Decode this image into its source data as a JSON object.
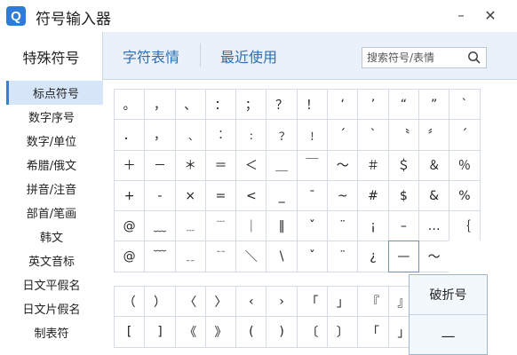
{
  "app": {
    "logo_letter": "Q",
    "title": "符号输入器",
    "minimize_glyph": "–",
    "close_glyph": "✕"
  },
  "tabs": [
    {
      "label": "特殊符号",
      "active": true
    },
    {
      "label": "字符表情",
      "active": false
    },
    {
      "label": "最近使用",
      "active": false
    }
  ],
  "search": {
    "placeholder": "搜索符号/表情",
    "value": ""
  },
  "sidebar": {
    "items": [
      {
        "label": "标点符号",
        "active": true
      },
      {
        "label": "数字序号"
      },
      {
        "label": "数字/单位"
      },
      {
        "label": "希腊/俄文"
      },
      {
        "label": "拼音/注音"
      },
      {
        "label": "部首/笔画"
      },
      {
        "label": "韩文"
      },
      {
        "label": "英文音标"
      },
      {
        "label": "日文平假名"
      },
      {
        "label": "日文片假名"
      },
      {
        "label": "制表符"
      }
    ]
  },
  "symbol_grid": {
    "rows": [
      [
        "。",
        "，",
        "、",
        "：",
        "；",
        "？",
        "！",
        "‘",
        "’",
        "“",
        "”",
        "`"
      ],
      [
        "．",
        "，",
        "﹑",
        "︰",
        "﹕",
        "﹖",
        "﹗",
        "ˊ",
        "ˋ",
        "〝",
        "〞",
        "ˊ"
      ],
      [
        "＋",
        "－",
        "＊",
        "＝",
        "＜",
        "＿",
        "￣",
        "～",
        "＃",
        "＄",
        "＆",
        "％"
      ],
      [
        "+",
        "-",
        "×",
        "=",
        "<",
        "_",
        "¯",
        "~",
        "#",
        "$",
        "&",
        "%"
      ],
      [
        "@",
        "﹏",
        "﹍",
        "﹉",
        "｜",
        "‖",
        "ˇ",
        "¨",
        "¡",
        "–",
        "…",
        "｛"
      ],
      [
        "@",
        "﹋",
        "﹎",
        "﹊",
        "＼",
        "\\",
        "ˇ",
        "¨",
        "¿",
        "—",
        "～",
        ""
      ]
    ],
    "selected": "—"
  },
  "bracket_grid": {
    "rows": [
      [
        "（",
        "）",
        "〈",
        "〉",
        "‹",
        "›",
        "「",
        "」",
        "『",
        "』"
      ],
      [
        "[",
        "]",
        "《",
        "》",
        "(",
        ")",
        "〔",
        "〕",
        "「",
        "」"
      ]
    ]
  },
  "popup": {
    "name": "破折号",
    "glyph": "—"
  }
}
